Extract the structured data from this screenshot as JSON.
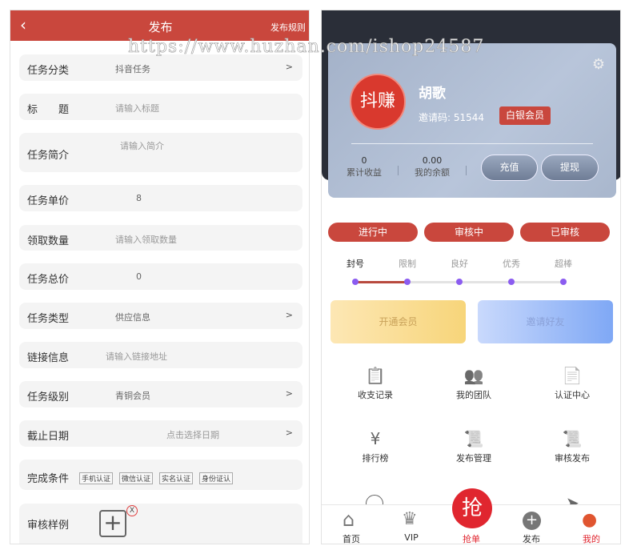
{
  "publish": {
    "title": "发布",
    "rules_link": "发布规则",
    "back_icon": "chevron-left-icon",
    "fields": [
      {
        "label": "任务分类",
        "value": "抖音任务",
        "arrow": ">"
      },
      {
        "label": "标　　题",
        "placeholder": "请输入标题"
      },
      {
        "label": "任务简介",
        "placeholder": "请输入简介"
      },
      {
        "label": "任务单价",
        "value": "8"
      },
      {
        "label": "领取数量",
        "placeholder": "请输入领取数量"
      },
      {
        "label": "任务总价",
        "value": "0"
      },
      {
        "label": "任务类型",
        "value": "供应信息",
        "arrow": ">"
      },
      {
        "label": "链接信息",
        "placeholder": "请输入链接地址"
      },
      {
        "label": "任务级别",
        "value": "青铜会员",
        "arrow": ">"
      },
      {
        "label": "截止日期",
        "placeholder": "点击选择日期",
        "arrow": ">"
      }
    ],
    "conditions": {
      "label": "完成条件",
      "options": [
        "手机认证",
        "微信认证",
        "实名认证",
        "身份证认"
      ]
    },
    "sample": {
      "label": "审核样例",
      "remove": "X"
    }
  },
  "profile": {
    "avatar_text": "抖赚",
    "name": "胡歌",
    "invite_code": "邀请码: 51544",
    "member_badge": "白银会员",
    "stats": [
      {
        "value": "0",
        "label": "累计收益"
      },
      {
        "value": "0.00",
        "label": "我的余额"
      }
    ],
    "recharge": "充值",
    "withdraw": "提现",
    "status_buttons": [
      "进行中",
      "审核中",
      "已审核"
    ],
    "levels": [
      "封号",
      "限制",
      "良好",
      "优秀",
      "超棒"
    ],
    "level_progress": 0.25,
    "banners": [
      "开通会员",
      "邀请好友"
    ],
    "grid": [
      {
        "label": "收支记录",
        "icon": "clipboard-icon"
      },
      {
        "label": "我的团队",
        "icon": "team-icon"
      },
      {
        "label": "认证中心",
        "icon": "certificate-icon"
      },
      {
        "label": "排行榜",
        "icon": "yen-envelope-icon"
      },
      {
        "label": "发布管理",
        "icon": "publish-manage-icon"
      },
      {
        "label": "审核发布",
        "icon": "review-publish-icon"
      }
    ],
    "tabs": [
      "首页",
      "VIP",
      "抢单",
      "发布",
      "我的"
    ],
    "grab_text": "抢",
    "colors": {
      "accent": "#c9473d",
      "active_tab": "#e0262f",
      "level_dot": "#8b5cf0"
    }
  },
  "watermark": "https://www.huzhan.com/ishop24587"
}
